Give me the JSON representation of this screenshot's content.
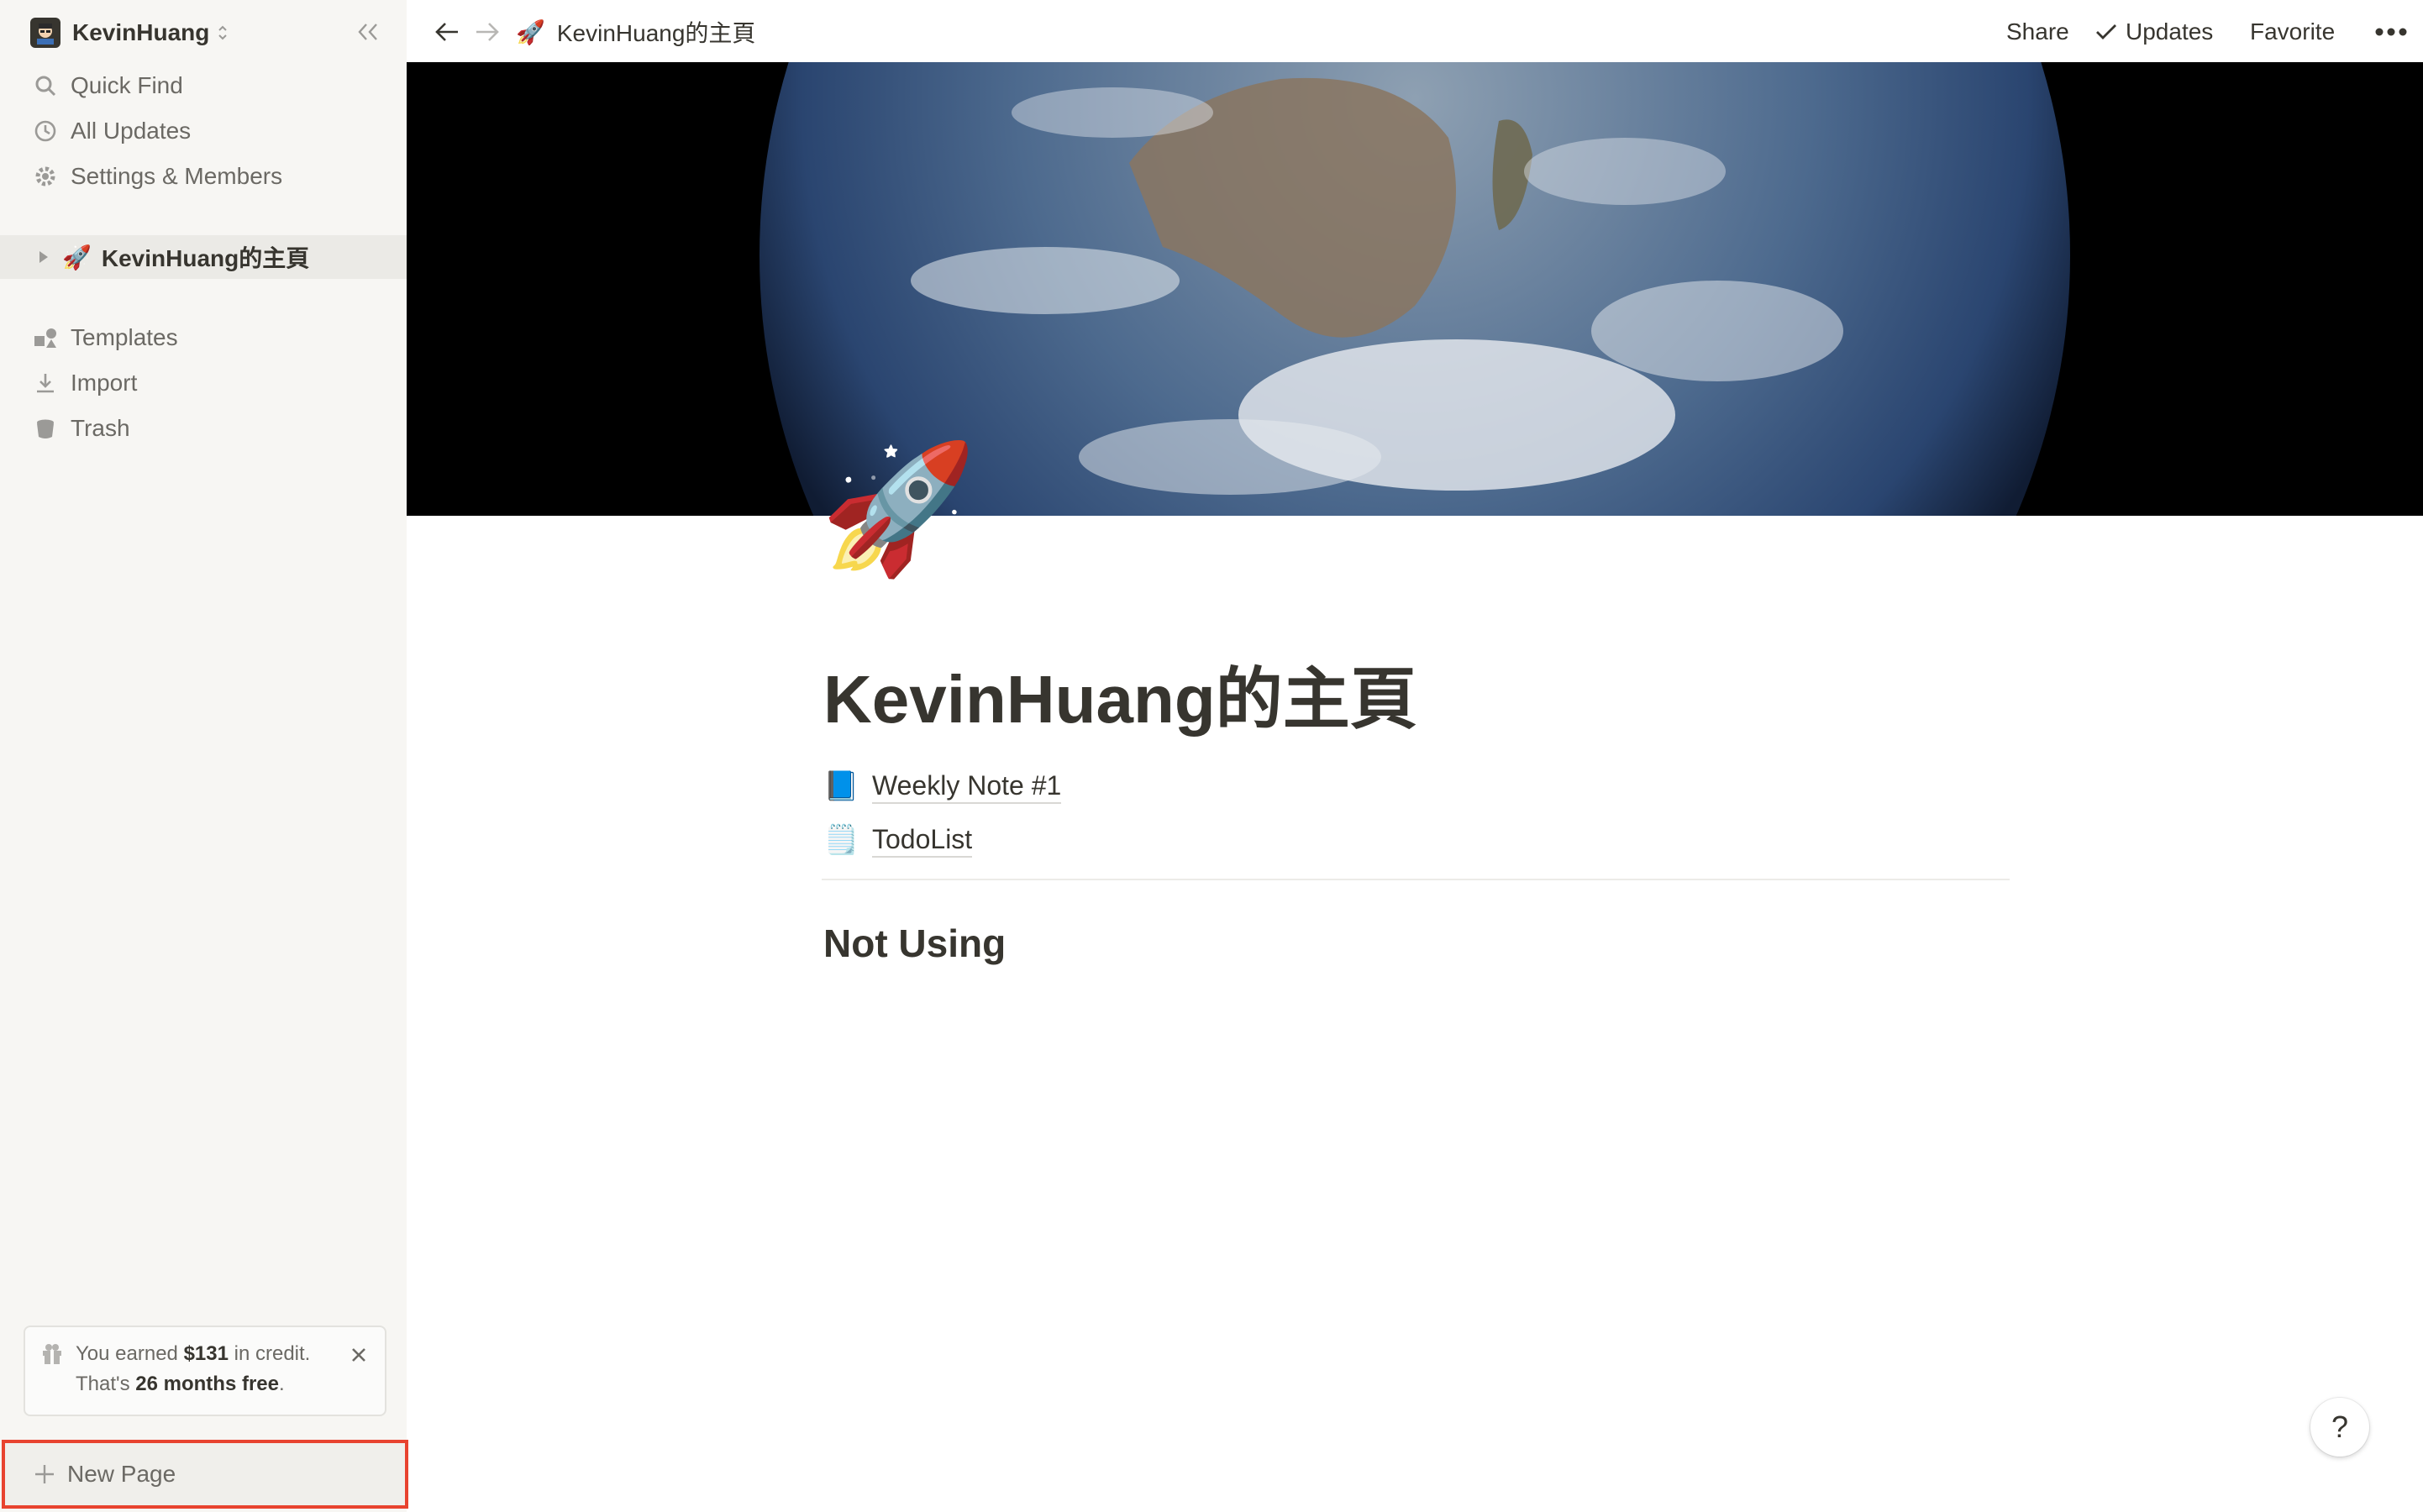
{
  "sidebar": {
    "workspace_name": "KevinHuang",
    "nav": [
      {
        "label": "Quick Find",
        "icon": "search-icon"
      },
      {
        "label": "All Updates",
        "icon": "clock-icon"
      },
      {
        "label": "Settings & Members",
        "icon": "gear-icon"
      }
    ],
    "page": {
      "emoji": "🚀",
      "label": "KevinHuang的主頁"
    },
    "bottom_nav": [
      {
        "label": "Templates",
        "icon": "templates-icon"
      },
      {
        "label": "Import",
        "icon": "import-icon"
      },
      {
        "label": "Trash",
        "icon": "trash-icon"
      }
    ],
    "credit": {
      "prefix": "You earned ",
      "amount": "$131",
      "suffix": " in credit.",
      "line2_prefix": "That's ",
      "months": "26 months free",
      "line2_suffix": "."
    },
    "new_page_label": "New Page"
  },
  "topbar": {
    "breadcrumb_emoji": "🚀",
    "breadcrumb_label": "KevinHuang的主頁",
    "share_label": "Share",
    "updates_label": "Updates",
    "favorite_label": "Favorite"
  },
  "page": {
    "icon": "🚀",
    "title": "KevinHuang的主頁",
    "links": [
      {
        "emoji": "📘",
        "label": "Weekly Note #1"
      },
      {
        "emoji": "🗒️",
        "label": "TodoList"
      }
    ],
    "heading": "Not Using"
  },
  "help_label": "?",
  "colors": {
    "sidebar_bg": "#f7f6f3",
    "text": "#37352f",
    "muted": "#6b6964",
    "highlight_border": "#e8432f"
  }
}
